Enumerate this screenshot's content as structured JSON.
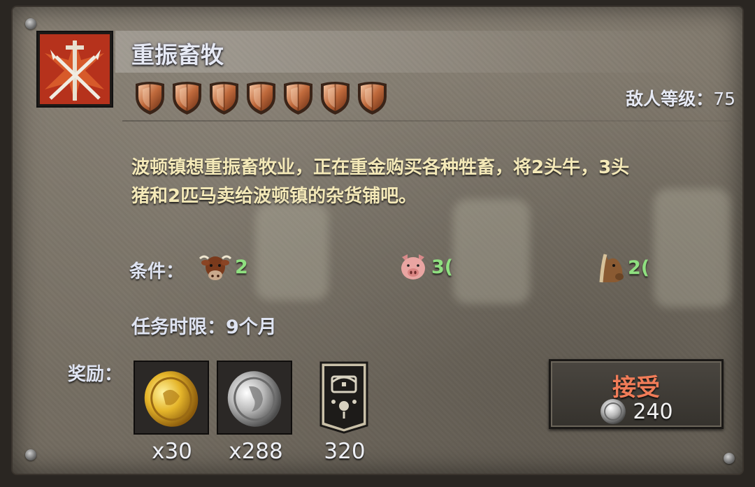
{
  "quest": {
    "title": "重振畜牧",
    "difficulty_shields": 7,
    "enemy_level_label": "敌人等级：",
    "enemy_level_value": "75",
    "description_line1": "波顿镇想重振畜牧业，正在重金购买各种牲畜，将2头牛，3头",
    "description_line2": "猪和2匹马卖给波顿镇的杂货铺吧。"
  },
  "conditions": {
    "label": "条件：",
    "items": [
      {
        "icon": "cow-icon",
        "value": "2"
      },
      {
        "icon": "pig-icon",
        "value": "3("
      },
      {
        "icon": "horse-icon",
        "value": "2("
      }
    ]
  },
  "deadline": {
    "text": "任务时限：9个月"
  },
  "rewards": {
    "label": "奖励：",
    "items": [
      {
        "icon": "gold-coin-icon",
        "count": "x30"
      },
      {
        "icon": "silver-coin-icon",
        "count": "x288"
      },
      {
        "icon": "chest-banner-icon",
        "count": "320"
      }
    ]
  },
  "accept": {
    "label": "接受",
    "cost": "240",
    "cost_icon": "silver-coin-icon"
  },
  "colors": {
    "title": "#e6e9f4",
    "description": "#f4e9b8",
    "condition_number": "#8fe080",
    "accept_label": "#f07c58"
  }
}
